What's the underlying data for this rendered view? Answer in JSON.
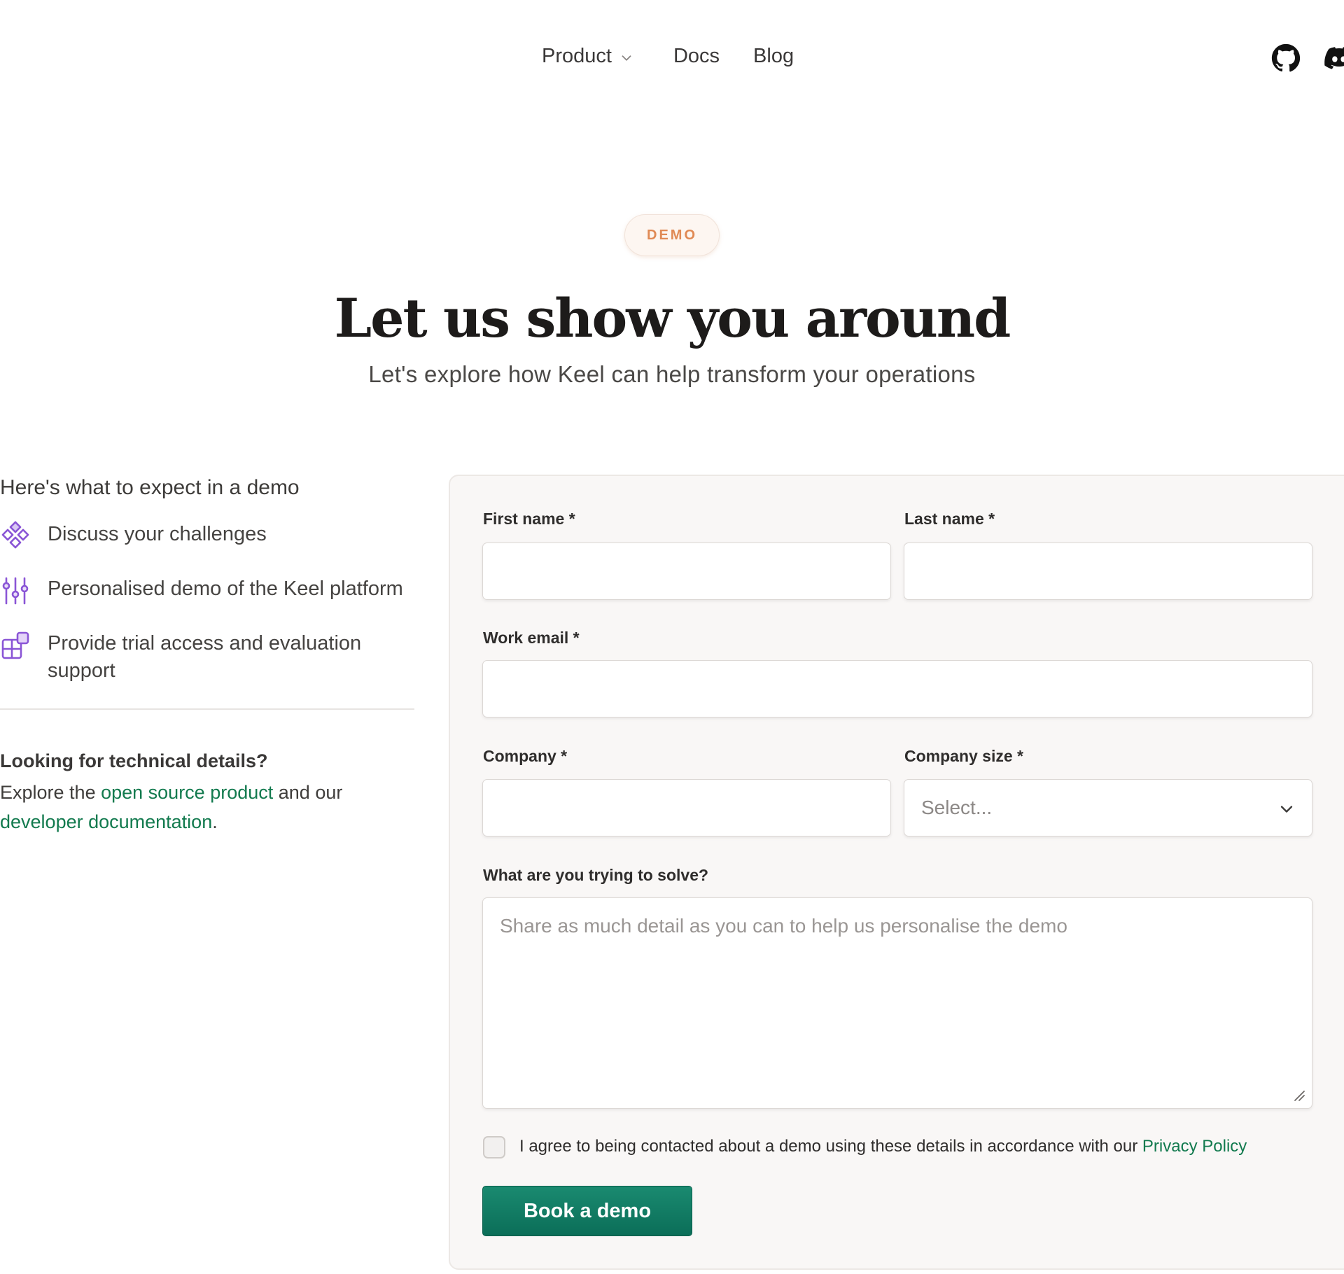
{
  "nav": {
    "items": [
      {
        "label": "Product"
      },
      {
        "label": "Docs"
      },
      {
        "label": "Blog"
      }
    ],
    "icons": [
      "github-icon",
      "discord-icon"
    ]
  },
  "hero": {
    "badge": "DEMO",
    "title": "Let us show you around",
    "subtitle": "Let's explore how Keel can help transform your operations"
  },
  "expect": {
    "title": "Here's what to expect in a demo",
    "items": [
      {
        "label": "Discuss your challenges",
        "icon": "diamonds-icon"
      },
      {
        "label": "Personalised demo of the Keel platform",
        "icon": "sliders-icon"
      },
      {
        "label": "Provide trial access and evaluation support",
        "icon": "blocks-icon"
      }
    ]
  },
  "tech": {
    "title": "Looking for technical details?",
    "text_before": "Explore the ",
    "link1": "open source product",
    "text_middle": " and our ",
    "link2": "developer documentation",
    "text_after": "."
  },
  "form": {
    "first_name_label": "First name *",
    "last_name_label": "Last name *",
    "email_label": "Work email *",
    "company_label": "Company *",
    "company_size_label": "Company size *",
    "company_size_value": "Select...",
    "solve_label": "What are you trying to solve?",
    "solve_placeholder": "Share as much detail as you can to help us personalise the demo",
    "consent_text": "I agree to being contacted about a demo using these details in accordance with our ",
    "privacy_link": "Privacy Policy",
    "submit_label": "Book a demo"
  },
  "colors": {
    "accent_green": "#127a4e",
    "button_green": "#0b6e58",
    "badge_orange": "#e08a55",
    "icon_purple": "#8a55d6"
  }
}
